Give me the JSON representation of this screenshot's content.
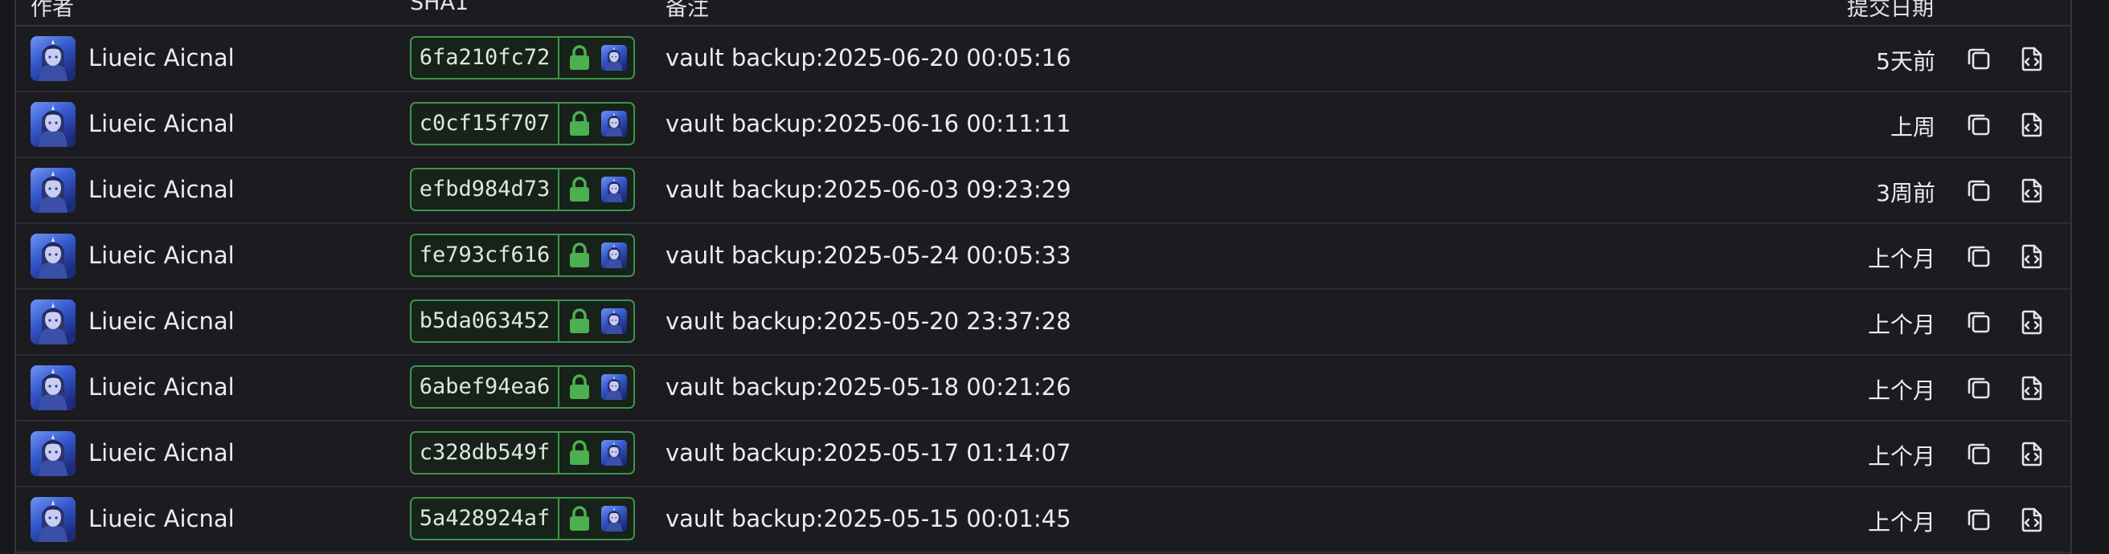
{
  "columns": {
    "author": "作者",
    "sha": "SHA1",
    "message": "备注",
    "date": "提交日期"
  },
  "commits": [
    {
      "author": "Liueic Aicnal",
      "sha": "6fa210fc72",
      "message": "vault backup:2025-06-20 00:05:16",
      "date": "5天前"
    },
    {
      "author": "Liueic Aicnal",
      "sha": "c0cf15f707",
      "message": "vault backup:2025-06-16 00:11:11",
      "date": "上周"
    },
    {
      "author": "Liueic Aicnal",
      "sha": "efbd984d73",
      "message": "vault backup:2025-06-03 09:23:29",
      "date": "3周前"
    },
    {
      "author": "Liueic Aicnal",
      "sha": "fe793cf616",
      "message": "vault backup:2025-05-24 00:05:33",
      "date": "上个月"
    },
    {
      "author": "Liueic Aicnal",
      "sha": "b5da063452",
      "message": "vault backup:2025-05-20 23:37:28",
      "date": "上个月"
    },
    {
      "author": "Liueic Aicnal",
      "sha": "6abef94ea6",
      "message": "vault backup:2025-05-18 00:21:26",
      "date": "上个月"
    },
    {
      "author": "Liueic Aicnal",
      "sha": "c328db549f",
      "message": "vault backup:2025-05-17 01:14:07",
      "date": "上个月"
    },
    {
      "author": "Liueic Aicnal",
      "sha": "5a428924af",
      "message": "vault backup:2025-05-15 00:01:45",
      "date": "上个月"
    }
  ],
  "icons": {
    "lock": "lock-icon",
    "copy": "copy-icon",
    "browse": "browse-files-icon"
  },
  "colors": {
    "verified_green": "#3f9447",
    "lock_green": "#4caf50"
  }
}
